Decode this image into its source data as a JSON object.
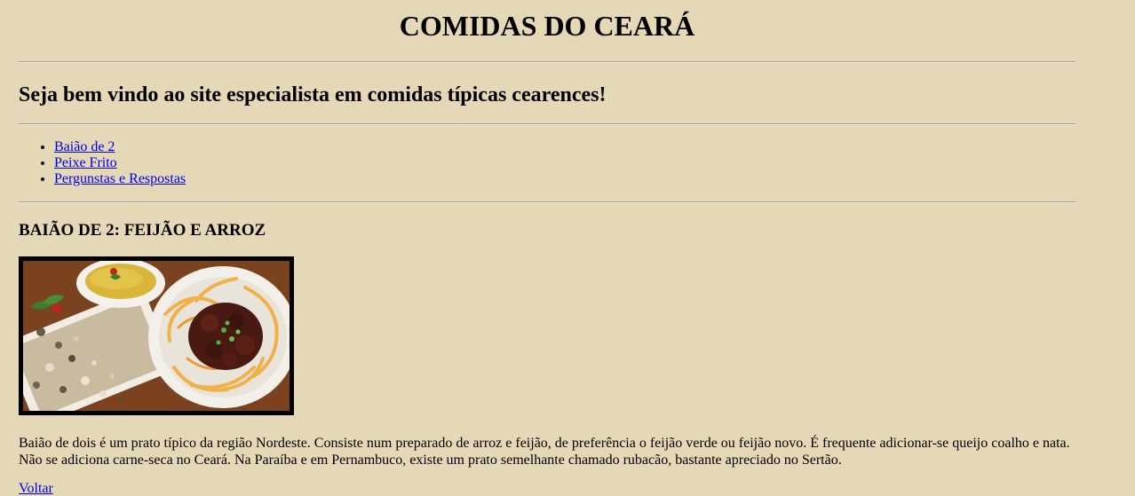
{
  "page": {
    "title": "COMIDAS DO CEARÁ",
    "welcome": "Seja bem vindo ao site especialista em comidas típicas cearences!"
  },
  "nav": {
    "items": [
      {
        "label": "Baião de 2"
      },
      {
        "label": "Peixe Frito"
      },
      {
        "label": "Pergunstas e Respostas"
      }
    ]
  },
  "section": {
    "heading": "BAIÃO DE 2: FEIJÃO E ARROZ",
    "image_alt": "Prato de baião de dois com carne-seca, cebola e farofa",
    "description": "Baião de dois é um prato típico da região Nordeste. Consiste num preparado de arroz e feijão, de preferência o feijão verde ou feijão novo. É frequente adicionar-se queijo coalho e nata. Não se adiciona carne-seca no Ceará. Na Paraíba e em Pernambuco, existe um prato semelhante chamado rubacão, bastante apreciado no Sertão.",
    "back_link": "Voltar"
  },
  "colors": {
    "background": "#e4d8b7",
    "link": "#0000ee",
    "text": "#000000"
  }
}
